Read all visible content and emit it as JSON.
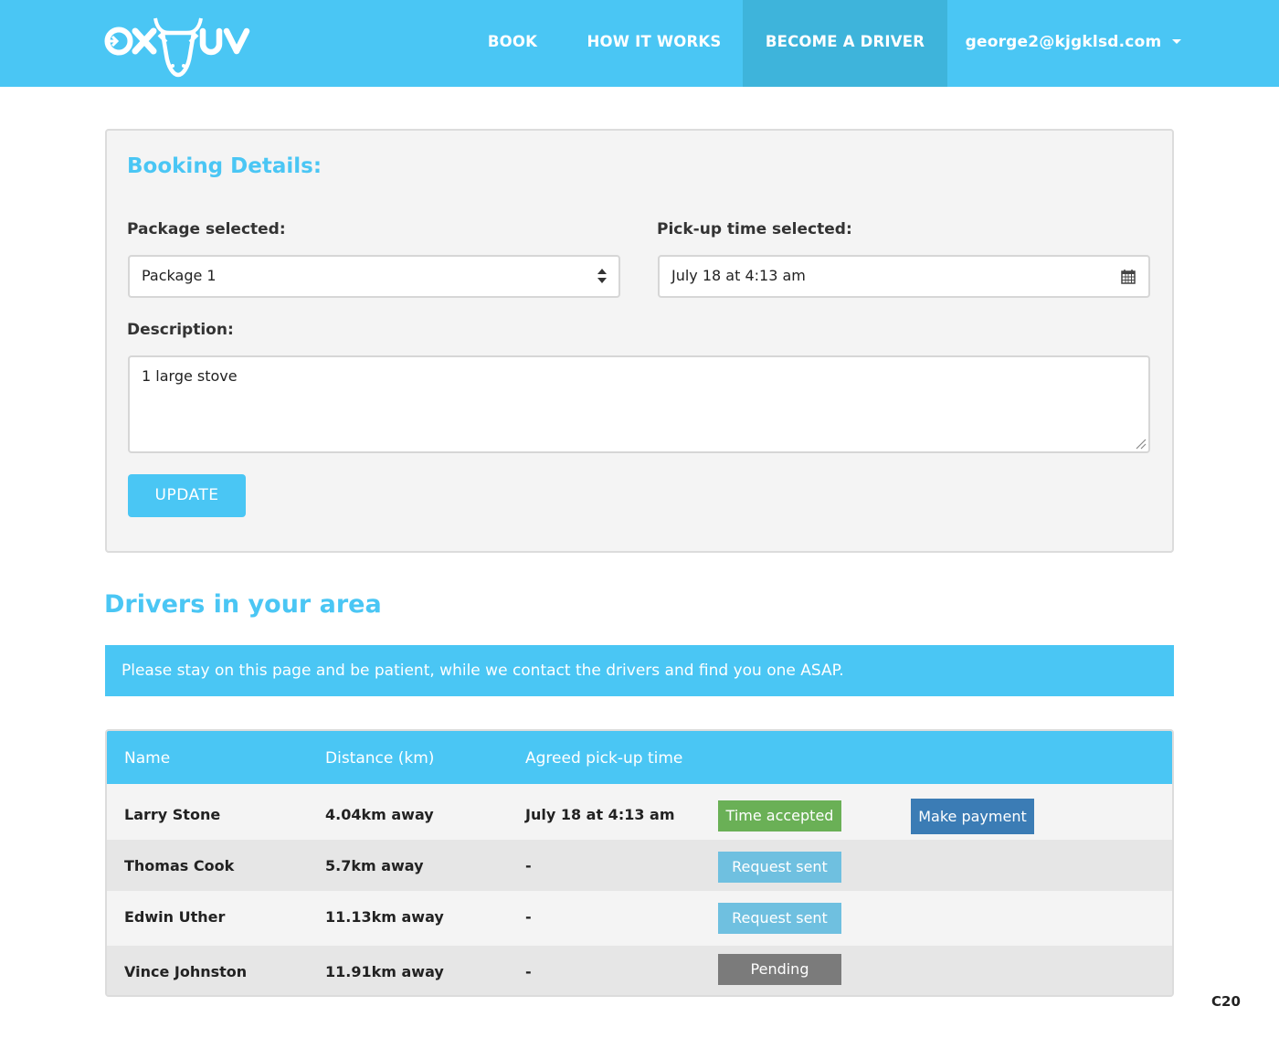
{
  "header": {
    "logo_text": "OXMUV",
    "nav": {
      "book": "BOOK",
      "how": "HOW IT WORKS",
      "driver": "BECOME A DRIVER",
      "user": "george2@kjgklsd.com"
    },
    "colors": {
      "bar": "#4ac6f4",
      "active": "#3eb4db"
    }
  },
  "booking": {
    "title": "Booking Details:",
    "package_label": "Package selected:",
    "package_value": "Package 1",
    "time_label": "Pick-up time selected:",
    "time_value": "July 18 at 4:13 am",
    "description_label": "Description:",
    "description_value": "1 large stove",
    "update_label": "UPDATE"
  },
  "drivers": {
    "title": "Drivers in your area",
    "notice": "Please stay on this page and be patient, while we contact the drivers and find you one ASAP.",
    "columns": [
      "Name",
      "Distance (km)",
      "Agreed pick-up time"
    ],
    "rows": [
      {
        "name": "Larry Stone",
        "distance": "4.04km away",
        "time": "July 18 at 4:13 am",
        "status": "Time accepted",
        "action": "Make payment"
      },
      {
        "name": "Thomas Cook",
        "distance": "5.7km away",
        "time": "-",
        "status": "Request sent"
      },
      {
        "name": "Edwin Uther",
        "distance": "11.13km away",
        "time": "-",
        "status": "Request sent"
      },
      {
        "name": "Vince Johnston",
        "distance": "11.91km away",
        "time": "-",
        "status": "Pending"
      }
    ],
    "status_colors": {
      "accepted": "#6ab056",
      "request": "#6fc0e0",
      "pending": "#7b7b7b",
      "payment": "#3b7cb5"
    }
  },
  "corner_code": "C20"
}
